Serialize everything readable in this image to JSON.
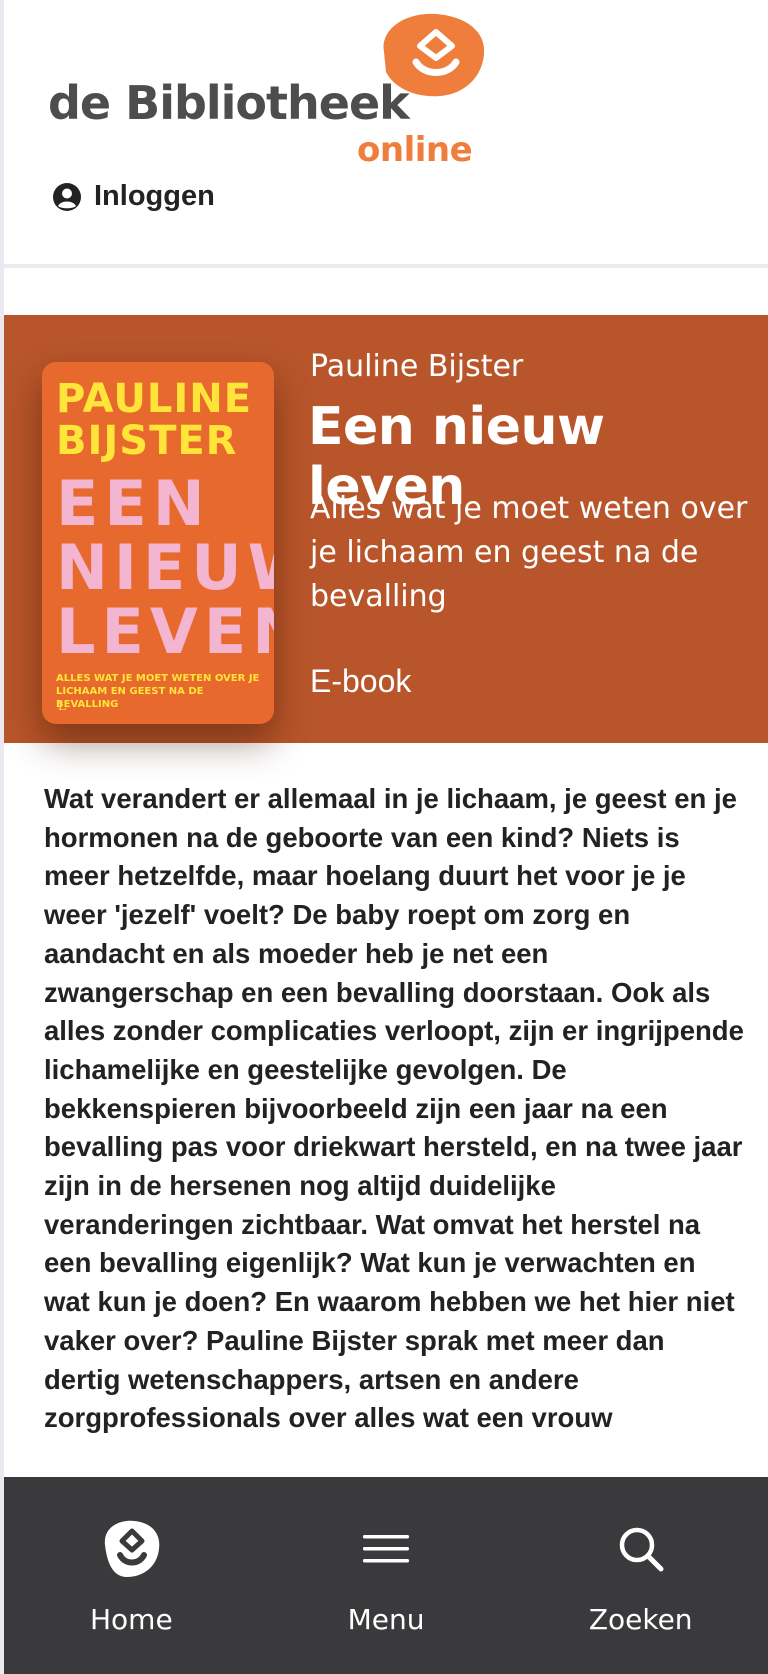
{
  "header": {
    "logo_text": "de Bibliotheek",
    "logo_sub": "online",
    "login_label": "Inloggen"
  },
  "book": {
    "author": "Pauline Bijster",
    "title": "Een nieuw leven",
    "subtitle": "Alles wat je moet weten over je lichaam en geest na de bevalling",
    "format": "E-book",
    "cover": {
      "author": "PAULINE BIJSTER",
      "title": "EEN NIEUW LEVEN",
      "subtitle": "ALLES WAT JE MOET WETEN OVER JE LICHAAM EN GEEST NA DE BEVALLING",
      "mark": "L"
    },
    "description": "Wat verandert er allemaal in je lichaam, je geest en je hormonen na de geboorte van een kind? Niets is meer hetzelfde, maar hoelang duurt het voor je je weer 'jezelf' voelt? De baby roept om zorg en aandacht en als moeder heb je net een zwangerschap en een bevalling doorstaan. Ook als alles zonder complicaties verloopt, zijn er ingrijpende lichamelijke en geestelijke gevolgen. De bekkenspieren bijvoorbeeld zijn een jaar na een bevalling pas voor driekwart hersteld, en na twee jaar zijn in de hersenen nog altijd duidelijke veranderingen zichtbaar. Wat omvat het herstel na een bevalling eigenlijk? Wat kun je verwachten en wat kun je doen? En waarom hebben we het hier niet vaker over? Pauline Bijster sprak met meer dan dertig wetenschappers, artsen en andere zorgprofessionals over alles wat een vrouw"
  },
  "nav": {
    "home_label": "Home",
    "menu_label": "Menu",
    "search_label": "Zoeken"
  },
  "colors": {
    "brand_orange": "#ef7d3c",
    "hero_background": "#b8552a",
    "nav_background": "#3a3a3d"
  },
  "icons": {
    "logo": "bibliotheek-logo-icon",
    "login": "user-circle-icon",
    "home": "bibliotheek-home-icon",
    "menu": "hamburger-menu-icon",
    "search": "search-icon"
  }
}
